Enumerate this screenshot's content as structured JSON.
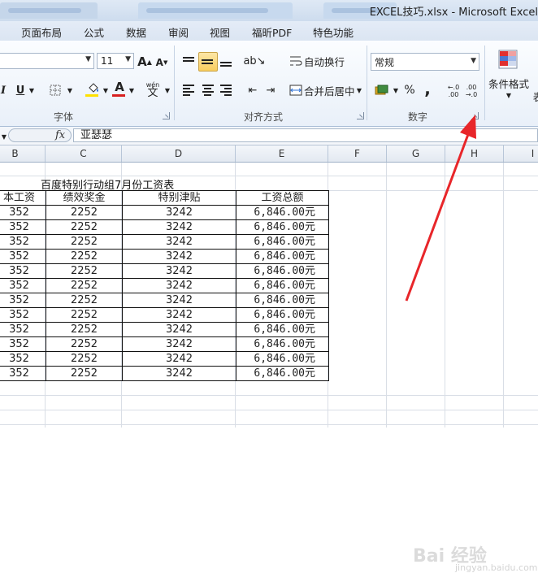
{
  "window": {
    "title": "EXCEL技巧.xlsx  -  Microsoft Excel",
    "tabs": [
      "",
      "",
      ""
    ]
  },
  "menu": [
    "页面布局",
    "公式",
    "数据",
    "审阅",
    "视图",
    "福昕PDF",
    "特色功能"
  ],
  "ribbon": {
    "font_group": {
      "label": "字体",
      "font_size": "11",
      "grow_font": "A",
      "shrink_font": "A",
      "italic": "I",
      "underline": "U",
      "font_color_letter": "A",
      "wen": "wén",
      "wen_char": "文"
    },
    "align_group": {
      "label": "对齐方式",
      "wrap_text": "自动换行",
      "merge_center": "合并后居中"
    },
    "number_group": {
      "label": "数字",
      "format": "常规",
      "percent": "%",
      "comma": ",",
      "inc_decimal": ".00",
      "dec_decimal": ".00"
    },
    "styles_group": {
      "conditional_format": "条件格式",
      "table_format_partial": "表"
    }
  },
  "formula_bar": {
    "fx": "fx",
    "content": "亚瑟瑟"
  },
  "columns": [
    "B",
    "C",
    "D",
    "E",
    "F",
    "G",
    "H",
    "I"
  ],
  "sheet": {
    "title": "百度特别行动组7月份工资表",
    "headers": [
      "本工资",
      "绩效奖金",
      "特别津贴",
      "工资总额"
    ],
    "rows": [
      [
        "352",
        "2252",
        "3242",
        "6,846.00元"
      ],
      [
        "352",
        "2252",
        "3242",
        "6,846.00元"
      ],
      [
        "352",
        "2252",
        "3242",
        "6,846.00元"
      ],
      [
        "352",
        "2252",
        "3242",
        "6,846.00元"
      ],
      [
        "352",
        "2252",
        "3242",
        "6,846.00元"
      ],
      [
        "352",
        "2252",
        "3242",
        "6,846.00元"
      ],
      [
        "352",
        "2252",
        "3242",
        "6,846.00元"
      ],
      [
        "352",
        "2252",
        "3242",
        "6,846.00元"
      ],
      [
        "352",
        "2252",
        "3242",
        "6,846.00元"
      ],
      [
        "352",
        "2252",
        "3242",
        "6,846.00元"
      ],
      [
        "352",
        "2252",
        "3242",
        "6,846.00元"
      ],
      [
        "352",
        "2252",
        "3242",
        "6,846.00元"
      ]
    ]
  },
  "watermark": {
    "text": "Bai 经验",
    "sub": "jingyan.baidu.com"
  },
  "colors": {
    "annotation_arrow": "#e8262a",
    "ribbon_bg": "#e9f0f9",
    "active_button": "#f8cd5e"
  }
}
